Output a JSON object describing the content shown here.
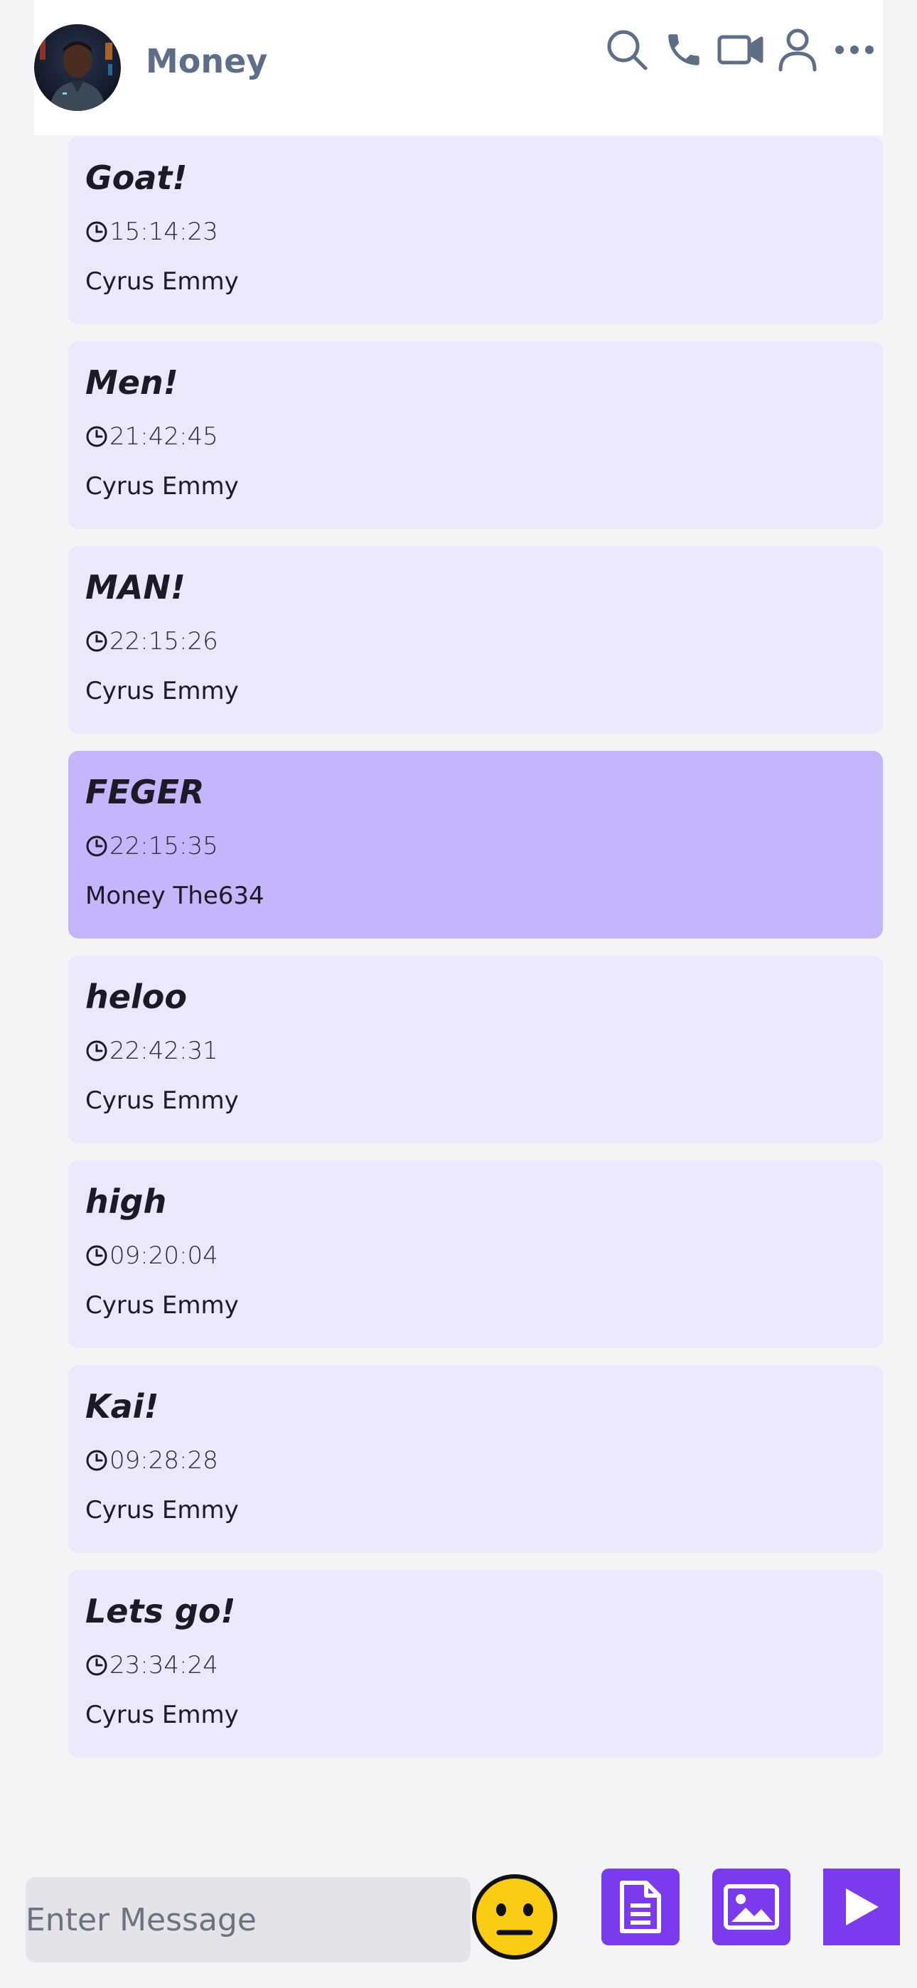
{
  "header": {
    "contact_name": "Money",
    "icons": [
      "search-icon",
      "phone-icon",
      "video-icon",
      "user-icon",
      "more-icon"
    ]
  },
  "messages": [
    {
      "text": "Goat!",
      "time": "15:14:23",
      "sender": "Cyrus Emmy"
    },
    {
      "text": "Men!",
      "time": "21:42:45",
      "sender": "Cyrus Emmy"
    },
    {
      "text": "MAN!",
      "time": "22:15:26",
      "sender": "Cyrus Emmy"
    },
    {
      "text": "FEGER",
      "time": "22:15:35",
      "sender": "Money The634"
    },
    {
      "text": "heloo",
      "time": "22:42:31",
      "sender": "Cyrus Emmy"
    },
    {
      "text": "high",
      "time": "09:20:04",
      "sender": "Cyrus Emmy"
    },
    {
      "text": "Kai!",
      "time": "09:28:28",
      "sender": "Cyrus Emmy"
    },
    {
      "text": "Lets go!",
      "time": "23:34:24",
      "sender": "Cyrus Emmy"
    }
  ],
  "composer": {
    "placeholder": "Enter Message",
    "value": ""
  },
  "colors": {
    "accent": "#7c3aed",
    "incoming_bubble": "#ebe8fc",
    "own_bubble": "#c4b5fd",
    "header_icon": "#5e6e86",
    "emoji_face": "#facc15"
  }
}
